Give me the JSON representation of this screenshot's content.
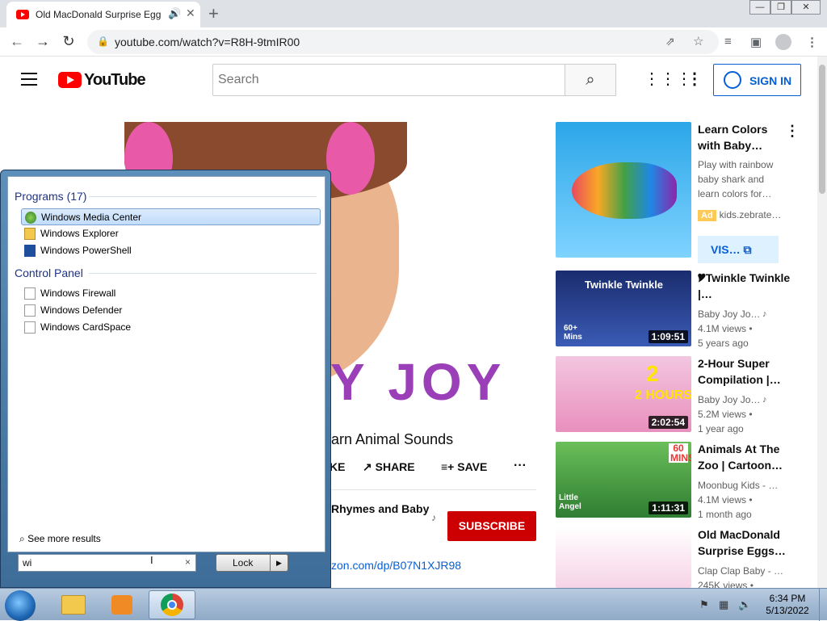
{
  "browser": {
    "tab_title": "Old MacDonald Surprise Egg",
    "url": "youtube.com/watch?v=R8H-9tmIR00",
    "icons": [
      "back-arrow-icon",
      "forward-arrow-icon",
      "reload-icon",
      "lock-icon",
      "share-icon",
      "star-icon",
      "media-icon",
      "sidepanel-icon",
      "profile-icon",
      "menu-dots-icon"
    ]
  },
  "youtube": {
    "logo_text": "YouTube",
    "search_placeholder": "Search",
    "sign_in": "SIGN IN",
    "video": {
      "title_visible": "arn Animal Sounds",
      "like_label": "KE",
      "share_label": "SHARE",
      "save_label": "SAVE",
      "channel_visible": "Rhymes and Baby",
      "subscribe_label": "SUBSCRIBE",
      "desc_link": "zon.com/dp/B07N1XJR98",
      "banner_text": "Y JOY"
    },
    "sidebar": {
      "ad": {
        "title": "Learn Colors with Baby…",
        "desc": "Play with rainbow baby shark and learn colors for…",
        "badge": "Ad",
        "advertiser": "kids.zebrate…",
        "visit_label": "VIS…"
      },
      "videos": [
        {
          "title": "🎔Twinkle Twinkle |…",
          "channel": "Baby Joy Jo…",
          "views": "4.1M views •",
          "age": "5 years ago",
          "duration": "1:09:51",
          "overlay": "Twinkle Twinkle",
          "corner": "60+ Mins"
        },
        {
          "title": "2-Hour Super Compilation |…",
          "channel": "Baby Joy Jo…",
          "views": "5.2M views •",
          "age": "1 year ago",
          "duration": "2:02:54",
          "overlay": "2 HOURS",
          "corner": ""
        },
        {
          "title": "Animals At The Zoo | Cartoon…",
          "channel": "Moonbug Kids - …",
          "views": "4.1M views •",
          "age": "1 month ago",
          "duration": "1:11:31",
          "overlay": "60 MINS",
          "corner": "Little Angel"
        },
        {
          "title": "Old MacDonald Surprise Eggs…",
          "channel": "Clap Clap Baby - …",
          "views": "245K views •",
          "age": "",
          "duration": "",
          "overlay": "",
          "corner": ""
        }
      ]
    }
  },
  "startmenu": {
    "programs_header": "Programs (17)",
    "programs": [
      "Windows Media Center",
      "Windows Explorer",
      "Windows PowerShell"
    ],
    "control_header": "Control Panel",
    "control": [
      "Windows Firewall",
      "Windows Defender",
      "Windows CardSpace"
    ],
    "see_more": "See more results",
    "search_value": "wi",
    "lock_label": "Lock"
  },
  "taskbar": {
    "time": "6:34 PM",
    "date": "5/13/2022"
  }
}
